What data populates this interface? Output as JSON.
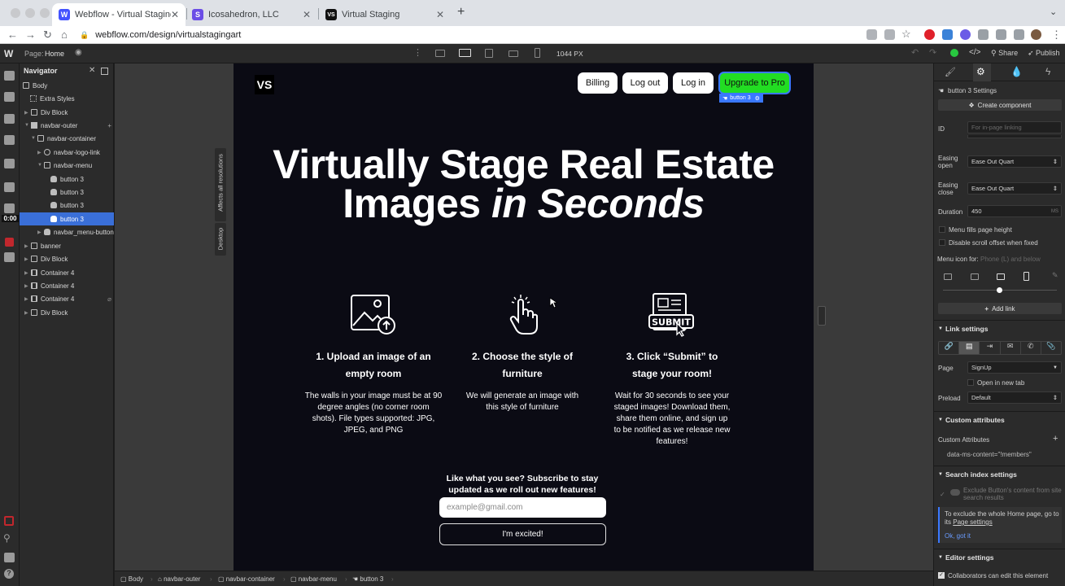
{
  "browser": {
    "tabs": [
      {
        "title": "Webflow - Virtual Staging",
        "favicon": "W",
        "favcolor": "#4353ff"
      },
      {
        "title": "Icosahedron, LLC",
        "favicon": "S",
        "favcolor": "#6b4de6"
      },
      {
        "title": "Virtual Staging",
        "favicon": "VS",
        "favcolor": "#111111"
      }
    ],
    "url": "webflow.com/design/virtualstagingart"
  },
  "wf_toolbar": {
    "page_label": "Page:",
    "page_name": "Home",
    "width_value": "1044 PX",
    "share": "Share",
    "publish": "Publish"
  },
  "timer": "0:00",
  "navigator": {
    "title": "Navigator",
    "items": [
      {
        "label": "Body"
      },
      {
        "label": "Extra Styles"
      },
      {
        "label": "Div Block"
      },
      {
        "label": "navbar-outer"
      },
      {
        "label": "navbar-container"
      },
      {
        "label": "navbar-logo-link"
      },
      {
        "label": "navbar-menu"
      },
      {
        "label": "button 3"
      },
      {
        "label": "button 3"
      },
      {
        "label": "button 3"
      },
      {
        "label": "button 3"
      },
      {
        "label": "navbar_menu-button"
      },
      {
        "label": "banner"
      },
      {
        "label": "Div Block"
      },
      {
        "label": "Container 4"
      },
      {
        "label": "Container 4"
      },
      {
        "label": "Container 4"
      },
      {
        "label": "Div Block"
      }
    ]
  },
  "canvas": {
    "vertical_label_1": "Affects all resolutions",
    "vertical_label_2": "Desktop",
    "logo": "VS",
    "nav_buttons": {
      "billing": "Billing",
      "logout": "Log out",
      "login": "Log in",
      "upgrade": "Upgrade to Pro"
    },
    "selected_tag": "button 3",
    "hero_line1": "Virtually Stage Real Estate",
    "hero_line2a": "Images ",
    "hero_line2b": "in Seconds",
    "steps": [
      {
        "title": "1. Upload an image of an empty room",
        "desc": "The walls in your image must be at 90 degree angles (no corner room shots). File types supported: JPG, JPEG, and PNG",
        "icon": "image-upload-icon"
      },
      {
        "title": "2. Choose the style of furniture",
        "desc": "We will generate an image with this style of furniture",
        "icon": "tap-hand-icon"
      },
      {
        "title": "3. Click “Submit” to stage your room!",
        "desc": "Wait for 30 seconds to see your staged images! Download them, share them online, and sign up to be notified as we release new features!",
        "icon": "submit-form-icon",
        "icon_text": "SUBMIT"
      }
    ],
    "subscribe": "Like what you see? Subscribe to stay updated as we roll out new features!",
    "email_placeholder": "example@gmail.com",
    "cta": "I'm excited!"
  },
  "settings": {
    "header": "button 3 Settings",
    "create_component": "Create component",
    "id_label": "ID",
    "id_placeholder": "For in-page linking",
    "easing_open_label": "Easing open",
    "easing_open": "Ease Out Quart",
    "easing_close_label": "Easing close",
    "easing_close": "Ease Out Quart",
    "duration_label": "Duration",
    "duration": "450",
    "duration_unit": "MS",
    "menu_fills": "Menu fills page height",
    "disable_scroll": "Disable scroll offset when fixed",
    "menu_icon_label": "Menu icon for:",
    "menu_icon_hint": "Phone (L) and below",
    "add_link": "Add link",
    "link_settings": "Link settings",
    "page_label": "Page",
    "page_value": "SignUp",
    "open_new_tab": "Open in new tab",
    "preload_label": "Preload",
    "preload_value": "Default",
    "custom_attributes_section": "Custom attributes",
    "custom_attributes_label": "Custom Attributes",
    "attr_value": "data-ms-content=\"!members\"",
    "search_index": "Search index settings",
    "exclude_text": "Exclude Button's content from site search results",
    "home_info": "To exclude the whole Home page, go to its",
    "home_info_link": "Page settings",
    "ok_got_it": "Ok, got it",
    "editor_settings": "Editor settings",
    "collaborators": "Collaborators can edit this element"
  },
  "breadcrumb": [
    "Body",
    "navbar-outer",
    "navbar-container",
    "navbar-menu",
    "button 3"
  ]
}
